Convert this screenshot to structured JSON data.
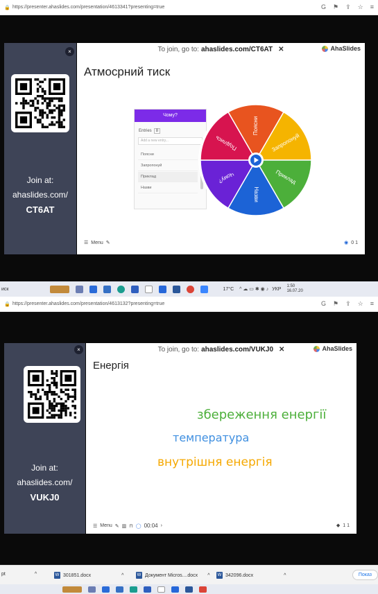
{
  "screen1": {
    "url": "https://presenter.ahaslides.com/presentation/4613341?presenting=true",
    "join_top": "To join, go to:",
    "join_link": "ahaslides.com/CT6AT",
    "brand": "AhaSlides",
    "sidebar": {
      "join_at": "Join at:",
      "domain": "ahaslides.com/",
      "code": "CT6AT"
    },
    "title": "Атмосрний тиск",
    "panel": {
      "button": "Чому?",
      "entries_label": "Entries",
      "entries_count": "8",
      "add_placeholder": "Add a new entry...",
      "rows": [
        "Поясни",
        "Запропонуй",
        "Приклад",
        "Назви"
      ]
    },
    "wheel": {
      "segments": [
        {
          "label": "Поясни",
          "color": "#e8541f"
        },
        {
          "label": "Запропонуй",
          "color": "#f5b400"
        },
        {
          "label": "Приклад",
          "color": "#4caf3a"
        },
        {
          "label": "Назви",
          "color": "#1c63d6"
        },
        {
          "label": "Чому?",
          "color": "#6a22d6"
        },
        {
          "label": "Поділись",
          "color": "#d7144f"
        }
      ]
    },
    "menu_label": "Menu",
    "counters": "0  1"
  },
  "taskbar1": {
    "search": "иск",
    "temp": "17°C",
    "lang": "УКР",
    "time": "1:50",
    "date": "16.07.20"
  },
  "screen2": {
    "url": "https://presenter.ahaslides.com/presentation/4613132?presenting=true",
    "join_top": "To join, go to:",
    "join_link": "ahaslides.com/VUKJ0",
    "brand": "AhaSlides",
    "sidebar": {
      "join_at": "Join at:",
      "domain": "ahaslides.com/",
      "code": "VUKJ0"
    },
    "title": "Енергія",
    "words": [
      {
        "text": "збереження енергії",
        "color": "#4caf3a"
      },
      {
        "text": "температура",
        "color": "#3f8fe0"
      },
      {
        "text": "внутрішня енергія",
        "color": "#f5a800"
      }
    ],
    "menu_label": "Menu",
    "timer": "00:04",
    "counters": "1  1"
  },
  "downloads": {
    "items": [
      "pt",
      "301851.docx",
      "Документ Micros....docx",
      "342096.docx"
    ],
    "show_all": "Показ"
  }
}
